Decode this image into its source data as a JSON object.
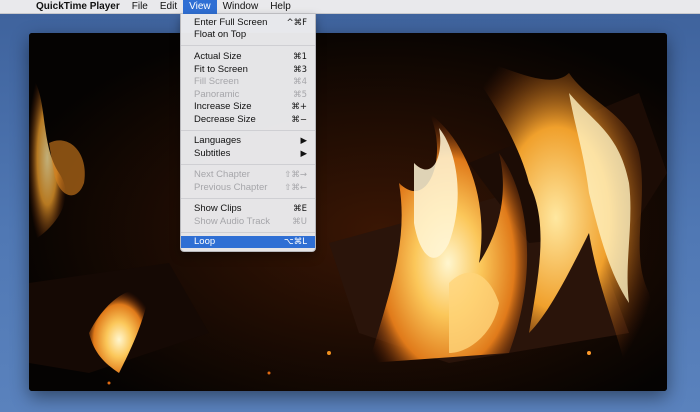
{
  "menubar": {
    "apple_glyph": "",
    "app_name": "QuickTime Player",
    "items": [
      {
        "label": "File"
      },
      {
        "label": "Edit"
      },
      {
        "label": "View"
      },
      {
        "label": "Window"
      },
      {
        "label": "Help"
      }
    ],
    "active_index": 2
  },
  "view_menu": {
    "groups": [
      [
        {
          "label": "Enter Full Screen",
          "shortcut": "^⌘F",
          "enabled": true
        },
        {
          "label": "Float on Top",
          "shortcut": "",
          "enabled": true
        }
      ],
      [
        {
          "label": "Actual Size",
          "shortcut": "⌘1",
          "enabled": true
        },
        {
          "label": "Fit to Screen",
          "shortcut": "⌘3",
          "enabled": true
        },
        {
          "label": "Fill Screen",
          "shortcut": "⌘4",
          "enabled": false
        },
        {
          "label": "Panoramic",
          "shortcut": "⌘5",
          "enabled": false
        },
        {
          "label": "Increase Size",
          "shortcut": "⌘+",
          "enabled": true
        },
        {
          "label": "Decrease Size",
          "shortcut": "⌘−",
          "enabled": true
        }
      ],
      [
        {
          "label": "Languages",
          "shortcut": "▶",
          "enabled": true
        },
        {
          "label": "Subtitles",
          "shortcut": "▶",
          "enabled": true
        }
      ],
      [
        {
          "label": "Next Chapter",
          "shortcut": "⇧⌘→",
          "enabled": false
        },
        {
          "label": "Previous Chapter",
          "shortcut": "⇧⌘←",
          "enabled": false
        }
      ],
      [
        {
          "label": "Show Clips",
          "shortcut": "⌘E",
          "enabled": true
        },
        {
          "label": "Show Audio Track",
          "shortcut": "⌘U",
          "enabled": false
        }
      ],
      [
        {
          "label": "Loop",
          "shortcut": "⌥⌘L",
          "enabled": true,
          "selected": true
        }
      ]
    ]
  },
  "video": {
    "content": "fireplace-flames",
    "colors": {
      "flame_core": "#fff3c2",
      "flame_mid": "#f5a623",
      "flame_outer": "#c2540c",
      "background": "#050302"
    }
  }
}
